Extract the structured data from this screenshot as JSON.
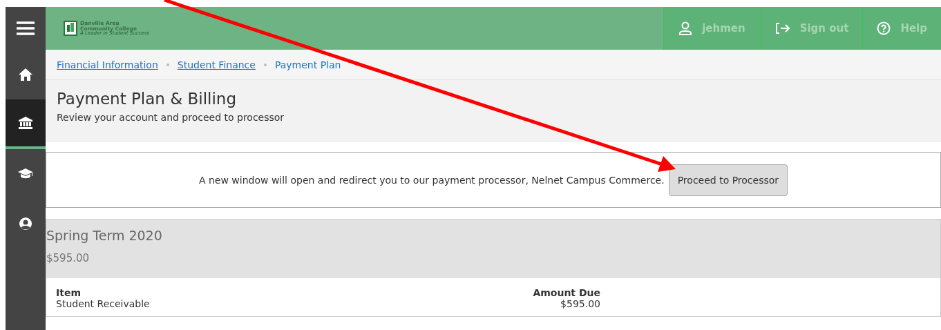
{
  "sidebar": {
    "items": [
      {
        "kind": "home",
        "selected": false
      },
      {
        "kind": "bank",
        "selected": true
      },
      {
        "kind": "cap",
        "selected": false
      },
      {
        "kind": "user",
        "selected": false
      }
    ]
  },
  "header": {
    "logo": {
      "name_line1": "Danville Area",
      "name_line2": "Community College",
      "tagline": "A Leader in Student Success"
    },
    "actions": [
      {
        "kind": "user",
        "label": "jehmen"
      },
      {
        "kind": "signout",
        "label": "Sign out"
      },
      {
        "kind": "help",
        "label": "Help"
      }
    ]
  },
  "breadcrumb": [
    {
      "label": "Financial Information",
      "link": true
    },
    {
      "label": "Student Finance",
      "link": true
    },
    {
      "label": "Payment Plan",
      "link": false
    }
  ],
  "page": {
    "title": "Payment Plan & Billing",
    "subtitle": "Review your account and proceed to processor"
  },
  "notice": {
    "text": "A new window will open and redirect you to our payment processor, Nelnet Campus Commerce.",
    "button": "Proceed to Processor"
  },
  "term": {
    "name": "Spring Term 2020",
    "total": "$595.00"
  },
  "table": {
    "columns": [
      "Item",
      "Amount Due"
    ],
    "rows": [
      [
        "Student Receivable",
        "$595.00"
      ]
    ]
  }
}
